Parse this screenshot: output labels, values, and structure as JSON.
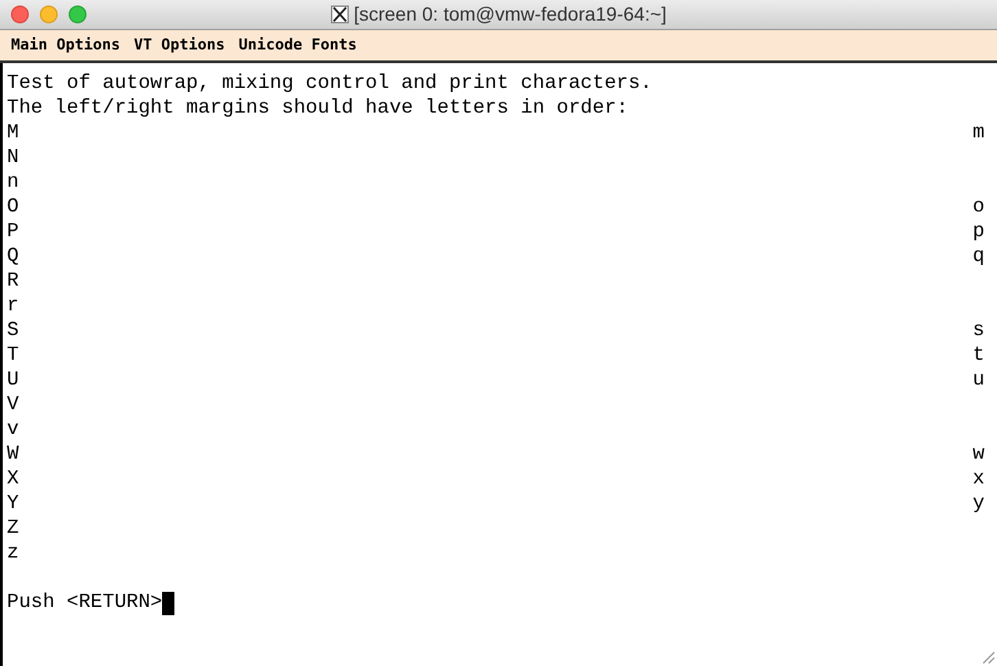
{
  "window": {
    "title": "[screen 0: tom@vmw-fedora19-64:~]"
  },
  "menu": [
    "Main Options",
    "VT Options",
    "Unicode Fonts"
  ],
  "terminal": {
    "lines": [
      "Test of autowrap, mixing control and print characters.",
      "The left/right margins should have letters in order:"
    ],
    "margin_rows": [
      {
        "left": "M",
        "right": "m"
      },
      {
        "left": "N"
      },
      {
        "left": "n"
      },
      {
        "left": "O",
        "right": "o"
      },
      {
        "left": "P",
        "right": "p"
      },
      {
        "left": "Q",
        "right": "q"
      },
      {
        "left": "R"
      },
      {
        "left": "r"
      },
      {
        "left": "S",
        "right": "s"
      },
      {
        "left": "T",
        "right": "t"
      },
      {
        "left": "U",
        "right": "u"
      },
      {
        "left": "V"
      },
      {
        "left": "v"
      },
      {
        "left": "W",
        "right": "w"
      },
      {
        "left": "X",
        "right": "x"
      },
      {
        "left": "Y",
        "right": "y"
      },
      {
        "left": "Z"
      },
      {
        "left": "z"
      }
    ],
    "prompt": "Push <RETURN>"
  }
}
